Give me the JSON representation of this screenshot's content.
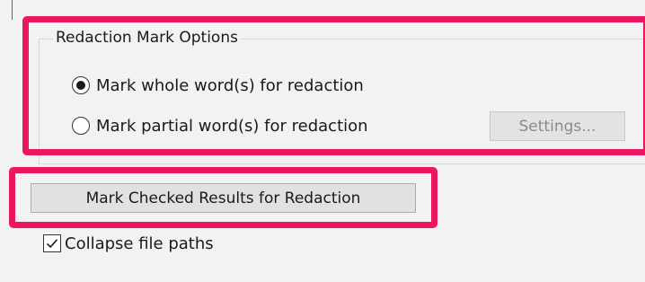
{
  "redaction_options": {
    "group_title": "Redaction Mark Options",
    "option_whole": {
      "label": "Mark whole word(s) for redaction",
      "selected": true
    },
    "option_partial": {
      "label": "Mark partial word(s) for redaction",
      "selected": false
    },
    "settings_button": {
      "label": "Settings...",
      "enabled": false
    }
  },
  "mark_button": {
    "label": "Mark Checked Results for Redaction"
  },
  "collapse_paths": {
    "label": "Collapse file paths",
    "checked": true
  },
  "colors": {
    "highlight": "#ec1561",
    "panel_background": "#f2f2f2"
  },
  "icons": {
    "checkbox_check": "check-icon",
    "radio_selected": "radio-dot-icon"
  }
}
